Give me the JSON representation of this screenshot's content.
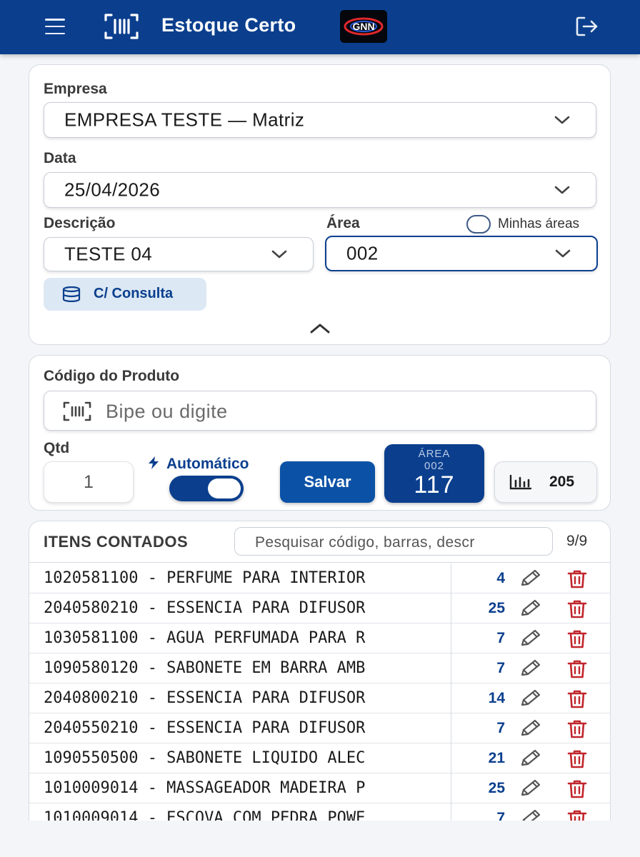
{
  "header": {
    "title": "Estoque Certo",
    "logo_text": "GNN",
    "accent_color": "#0b3f8e",
    "icons": [
      "menu-icon",
      "barcode-icon",
      "logout-icon"
    ]
  },
  "filters": {
    "empresa_label": "Empresa",
    "empresa_value": "EMPRESA TESTE — Matriz",
    "data_label": "Data",
    "data_value": "25/04/2026",
    "descricao_label": "Descrição",
    "descricao_value": "TESTE 04",
    "area_label": "Área",
    "area_value": "002",
    "minhas_areas_label": "Minhas áreas",
    "consulta_label": "C/ Consulta"
  },
  "entry": {
    "codigo_label": "Código do Produto",
    "codigo_placeholder": "Bipe ou digite",
    "qtd_label": "Qtd",
    "qtd_value": "1",
    "auto_label": "Automático",
    "auto_on": true,
    "salvar_label": "Salvar",
    "area_caption": "ÁREA",
    "area_code": "002",
    "area_count": "117",
    "total_count": "205"
  },
  "items": {
    "title": "ITENS CONTADOS",
    "search_placeholder": "Pesquisar código, barras, descr",
    "count": "9/9",
    "rows": [
      {
        "desc": "1020581100 - PERFUME PARA INTERIOR",
        "qty": "4"
      },
      {
        "desc": "2040580210 - ESSENCIA PARA DIFUSOR",
        "qty": "25"
      },
      {
        "desc": "1030581100 - AGUA PERFUMADA PARA R",
        "qty": "7"
      },
      {
        "desc": "1090580120 - SABONETE EM BARRA AMB",
        "qty": "7"
      },
      {
        "desc": "2040800210 - ESSENCIA PARA DIFUSOR",
        "qty": "14"
      },
      {
        "desc": "2040550210 - ESSENCIA PARA DIFUSOR",
        "qty": "7"
      },
      {
        "desc": "1090550500 - SABONETE LIQUIDO ALEC",
        "qty": "21"
      },
      {
        "desc": "1010009014 - MASSAGEADOR MADEIRA P",
        "qty": "25"
      },
      {
        "desc": "1010009014 - ESCOVA COM PEDRA POWE",
        "qty": "7"
      }
    ]
  }
}
